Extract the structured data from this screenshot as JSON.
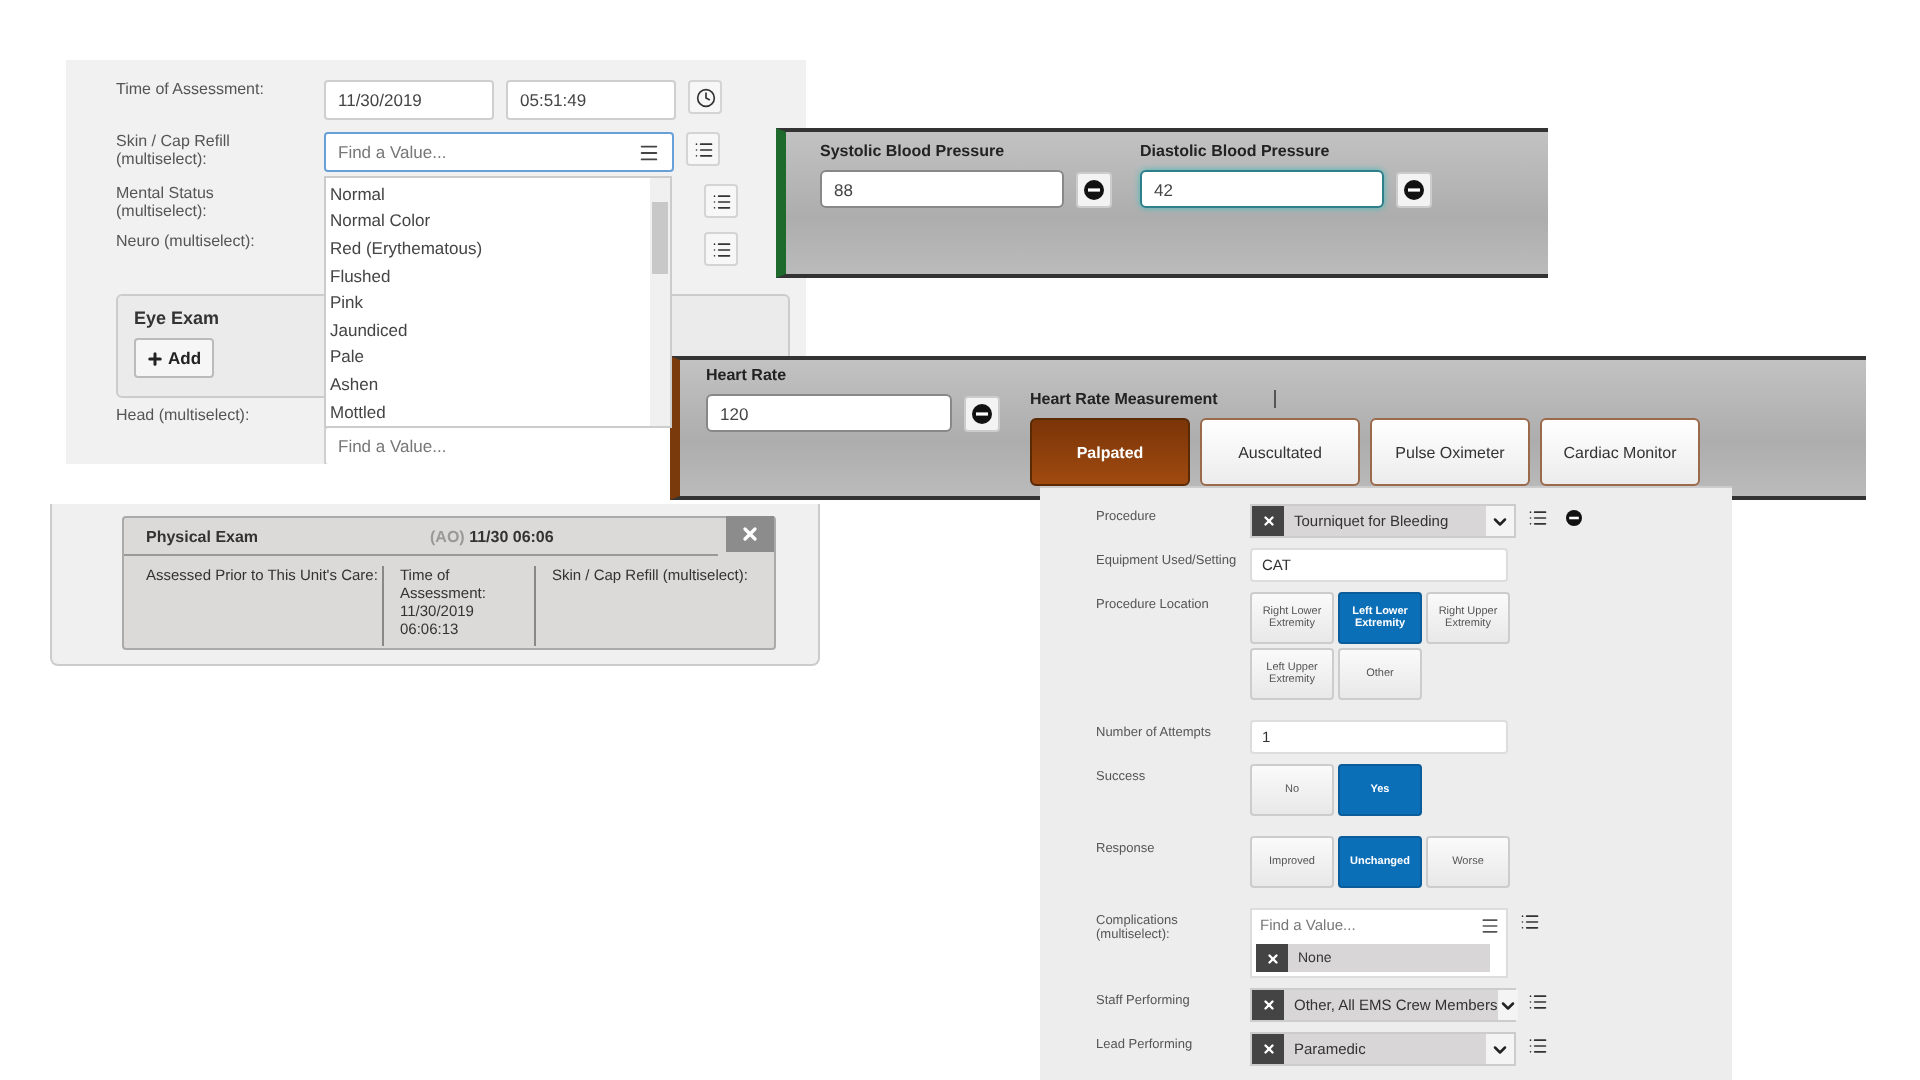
{
  "assessment_form": {
    "time_label": "Time of Assessment:",
    "date": "11/30/2019",
    "time": "05:51:49",
    "skin_field": {
      "label": "Skin / Cap Refill (multiselect):",
      "placeholder": "Find a Value..."
    },
    "other_labels": [
      "Mental Status (multiselect):",
      "Neuro (multiselect):"
    ],
    "dropdown": {
      "options": [
        "Normal",
        "Normal Color",
        "Red (Erythematous)",
        "Flushed",
        "Pink",
        "Jaundiced",
        "Pale",
        "Ashen",
        "Mottled"
      ]
    },
    "eye_exam": {
      "title": "Eye Exam",
      "add_button": "Add"
    },
    "head_field": {
      "label": "Head (multiselect):",
      "placeholder": "Find a Value..."
    }
  },
  "blood_pressure": {
    "fields": [
      {
        "label": "Systolic Blood Pressure",
        "value": "88",
        "focused": false
      },
      {
        "label": "Diastolic Blood Pressure",
        "value": "42",
        "focused": true
      }
    ]
  },
  "heart_rate": {
    "label": "Heart Rate",
    "value": "120",
    "measurement_label": "Heart Rate Measurement",
    "options": [
      {
        "label": "Palpated",
        "selected": true
      },
      {
        "label": "Auscultated",
        "selected": false
      },
      {
        "label": "Pulse Oximeter",
        "selected": false
      },
      {
        "label": "Cardiac Monitor",
        "selected": false
      }
    ]
  },
  "physical_exam": {
    "title": "Physical Exam",
    "agency": "(AO)",
    "timestamp": "11/30 06:06",
    "columns": [
      {
        "label": "Assessed Prior to This Unit's Care:"
      },
      {
        "label": "Time of Assessment:",
        "value": "11/30/2019 06:06:13"
      },
      {
        "label": "Skin / Cap Refill (multiselect):"
      }
    ]
  },
  "procedure": {
    "rows": [
      {
        "kind": "select",
        "label": "Procedure",
        "value": "Tourniquet for Bleeding",
        "removable": true
      },
      {
        "kind": "text",
        "label": "Equipment Used/Setting",
        "value": "CAT"
      },
      {
        "kind": "choices",
        "label": "Procedure Location",
        "options": [
          {
            "label": "Right Lower Extremity",
            "selected": false
          },
          {
            "label": "Left Lower Extremity",
            "selected": true
          },
          {
            "label": "Right Upper Extremity",
            "selected": false
          },
          {
            "label": "Left Upper Extremity",
            "selected": false
          },
          {
            "label": "Other",
            "selected": false
          }
        ]
      },
      {
        "kind": "text",
        "label": "Number of Attempts",
        "value": "1"
      },
      {
        "kind": "choices",
        "label": "Success",
        "options": [
          {
            "label": "No",
            "selected": false
          },
          {
            "label": "Yes",
            "selected": true
          }
        ]
      },
      {
        "kind": "choices",
        "label": "Response",
        "options": [
          {
            "label": "Improved",
            "selected": false
          },
          {
            "label": "Unchanged",
            "selected": true
          },
          {
            "label": "Worse",
            "selected": false
          }
        ]
      },
      {
        "kind": "multiselect",
        "label": "Complications (multiselect):",
        "placeholder": "Find a Value...",
        "tags": [
          "None"
        ]
      },
      {
        "kind": "select",
        "label": "Staff Performing",
        "value": "Other, All EMS Crew Members",
        "removable": false
      },
      {
        "kind": "select",
        "label": "Lead Performing",
        "value": "Paramedic",
        "removable": false
      }
    ]
  }
}
